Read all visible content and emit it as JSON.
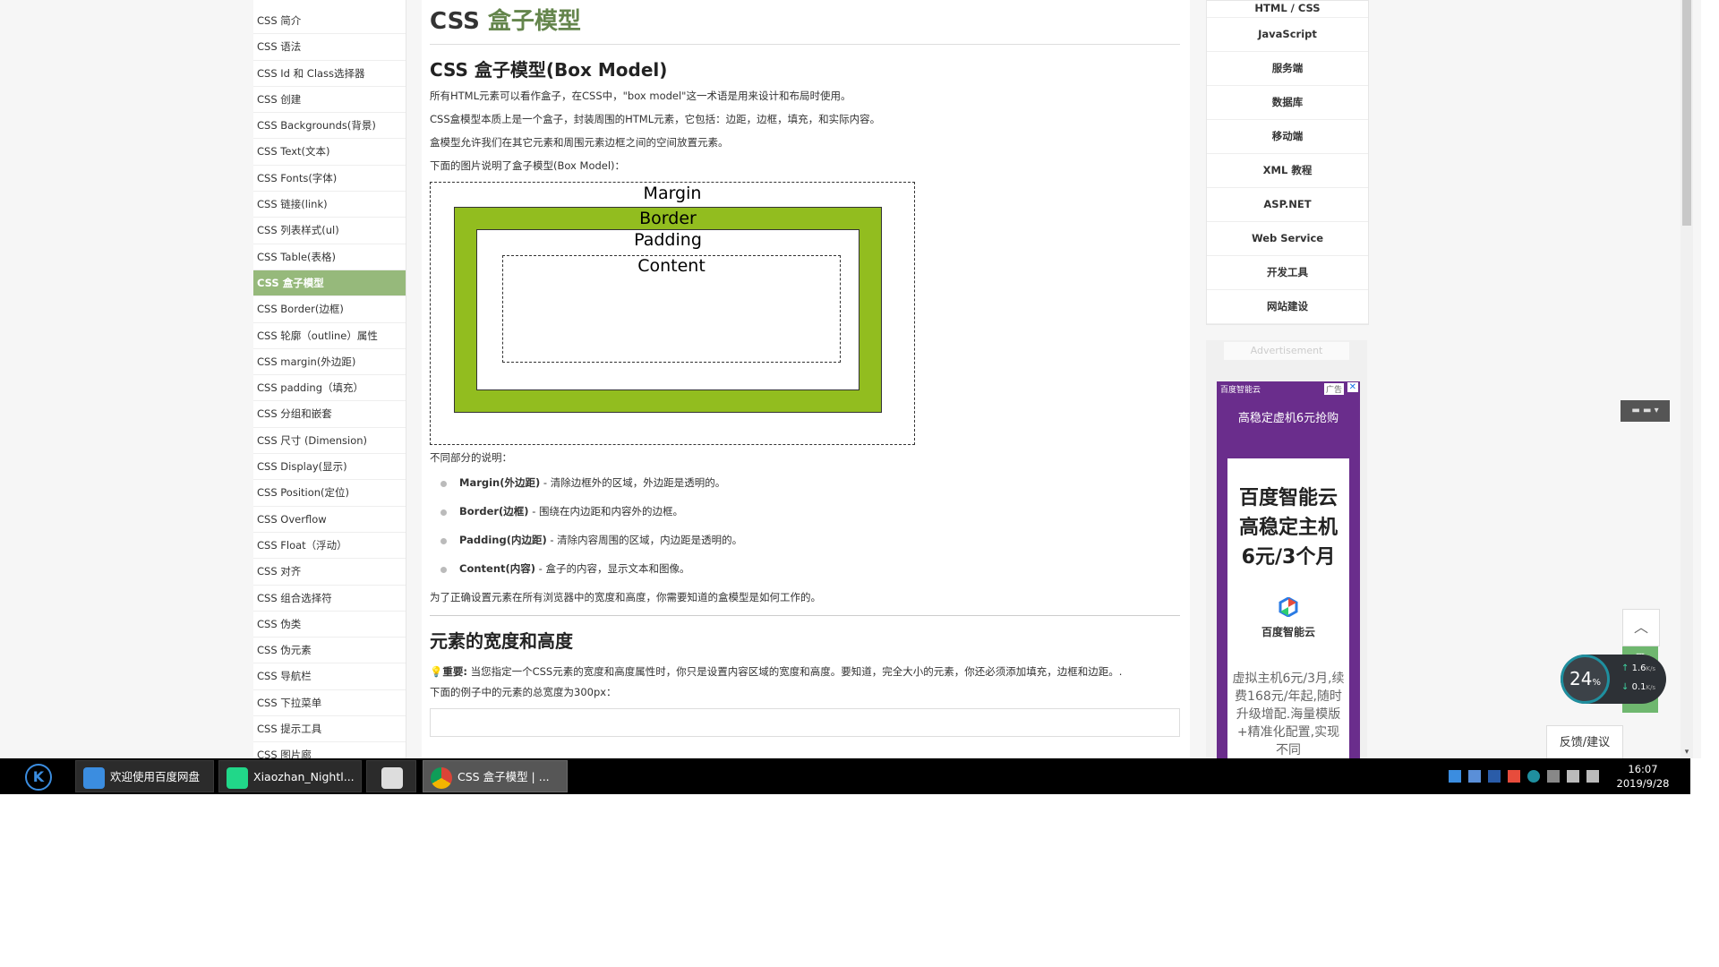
{
  "sidebar": {
    "items": [
      "CSS 简介",
      "CSS 语法",
      "CSS Id 和 Class选择器",
      "CSS 创建",
      "CSS Backgrounds(背景)",
      "CSS Text(文本)",
      "CSS Fonts(字体)",
      "CSS 链接(link)",
      "CSS 列表样式(ul)",
      "CSS Table(表格)",
      "CSS 盒子模型",
      "CSS Border(边框)",
      "CSS 轮廓（outline）属性",
      "CSS margin(外边距)",
      "CSS padding（填充）",
      "CSS 分组和嵌套",
      "CSS 尺寸 (Dimension)",
      "CSS Display(显示)",
      "CSS Position(定位)",
      "CSS Overflow",
      "CSS Float（浮动）",
      "CSS 对齐",
      "CSS 组合选择符",
      "CSS 伪类",
      "CSS 伪元素",
      "CSS 导航栏",
      "CSS 下拉菜单",
      "CSS 提示工具",
      "CSS 图片廊"
    ],
    "active_index": 10
  },
  "main": {
    "title_prefix": "CSS ",
    "title_highlight": "盒子模型",
    "section1_heading": "CSS 盒子模型(Box Model)",
    "intro": [
      "所有HTML元素可以看作盒子，在CSS中，\"box model\"这一术语是用来设计和布局时使用。",
      "CSS盒模型本质上是一个盒子，封装周围的HTML元素，它包括：边距，边框，填充，和实际内容。",
      "盒模型允许我们在其它元素和周围元素边框之间的空间放置元素。",
      "下面的图片说明了盒子模型(Box Model)："
    ],
    "diagram": {
      "margin": "Margin",
      "border": "Border",
      "padding": "Padding",
      "content": "Content"
    },
    "parts_intro": "不同部分的说明：",
    "parts": [
      {
        "term": "Margin(外边距)",
        "desc": " - 清除边框外的区域，外边距是透明的。"
      },
      {
        "term": "Border(边框)",
        "desc": " - 围绕在内边距和内容外的边框。"
      },
      {
        "term": "Padding(内边距)",
        "desc": " - 清除内容周围的区域，内边距是透明的。"
      },
      {
        "term": "Content(内容)",
        "desc": " - 盒子的内容，显示文本和图像。"
      }
    ],
    "parts_outro": "为了正确设置元素在所有浏览器中的宽度和高度，你需要知道的盒模型是如何工作的。",
    "section2_heading": "元素的宽度和高度",
    "important_label": "重要:",
    "important_text": " 当您指定一个CSS元素的宽度和高度属性时，你只是设置内容区域的宽度和高度。要知道，完全大小的元素，你还必须添加填充，边框和边距。.",
    "example_text": "下面的例子中的元素的总宽度为300px："
  },
  "right_nav": [
    "HTML / CSS",
    "JavaScript",
    "服务端",
    "数据库",
    "移动端",
    "XML 教程",
    "ASP.NET",
    "Web Service",
    "开发工具",
    "网站建设"
  ],
  "ad": {
    "label": "Advertisement",
    "badge": "广告",
    "close": "✕",
    "topbar": "百度智能云",
    "headline": "高稳定虚机6元抢购",
    "big_lines": [
      "百度智能云",
      "高稳定主机",
      "6元/3个月"
    ],
    "brand": "百度智能云",
    "desc": "虚拟主机6元/3月,续费168元/年起,随时升级增配.海量模版+精准化配置,实现不同"
  },
  "widgets": {
    "back_top": "︿",
    "feedback": "反馈/建议",
    "net_percent": "24",
    "net_percent_unit": "%",
    "net_up": "1.6",
    "net_down": "0.1",
    "net_unit": "K/s",
    "toolbar": "▬ ▬ ▾"
  },
  "taskbar": {
    "tasks": [
      "欢迎使用百度网盘",
      "Xiaozhan_Nightl...",
      "",
      "CSS 盒子模型 | ..."
    ],
    "time": "16:07",
    "date": "2019/9/28"
  },
  "colors": {
    "sidebar_active": "#96b97b",
    "title_highlight": "#64854c",
    "diagram_border": "#92bd1f",
    "ad_purple": "#6a2d8c",
    "float_green": "#6fb76f"
  }
}
